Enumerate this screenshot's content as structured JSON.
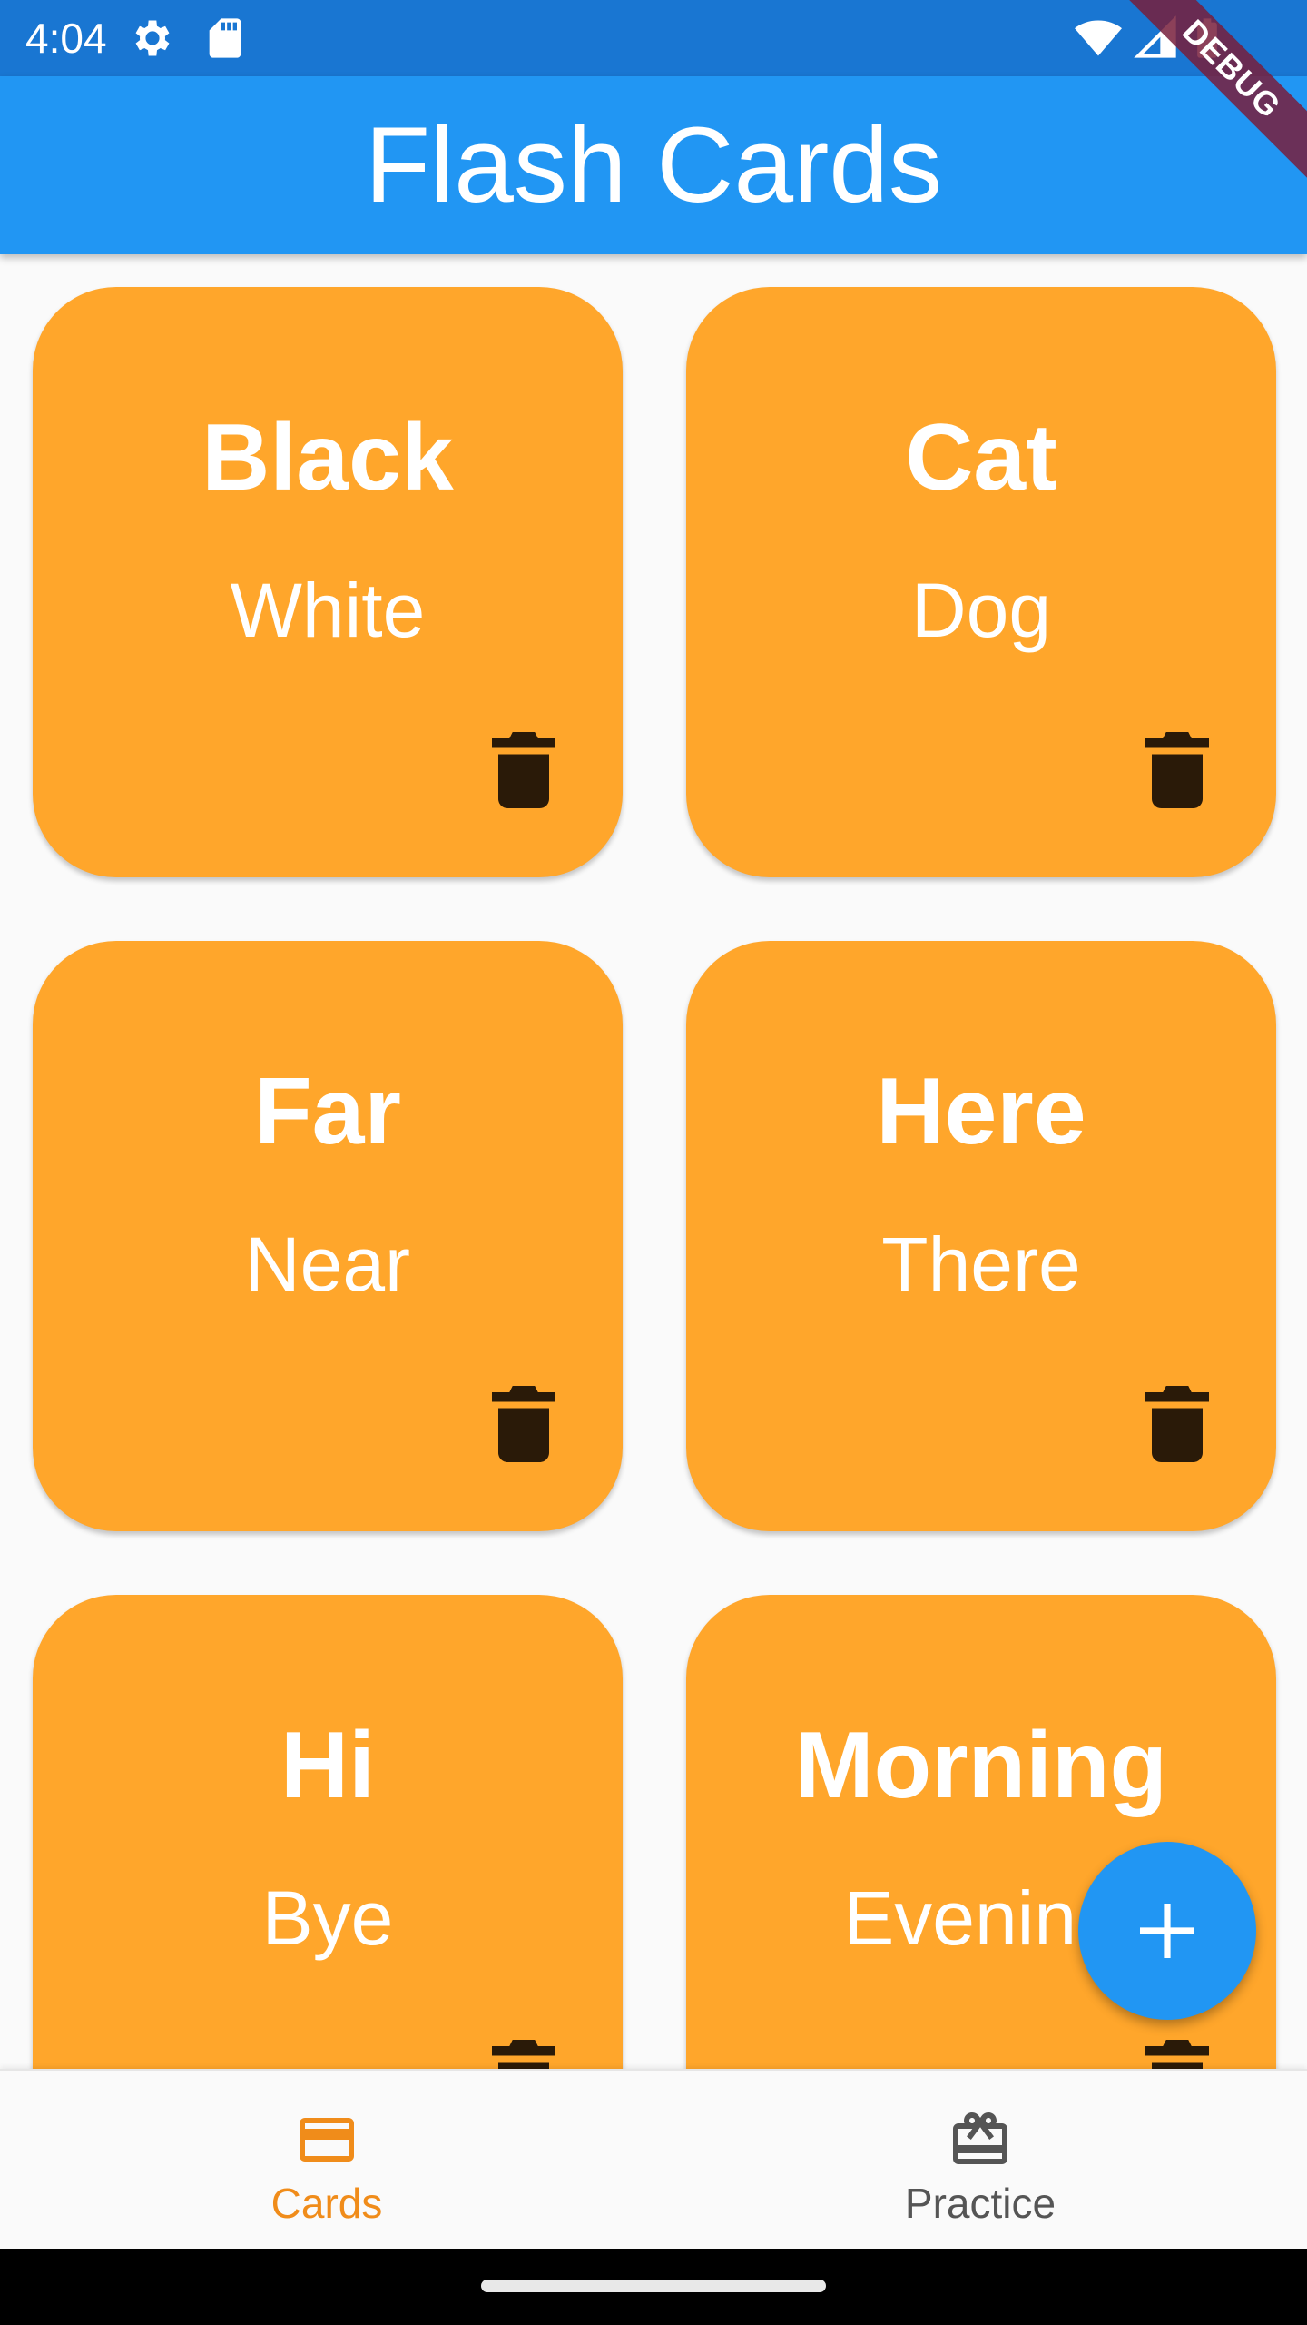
{
  "status_bar": {
    "time": "4:04",
    "icons": [
      "settings-icon",
      "sd-card-icon",
      "wifi-icon",
      "signal-icon",
      "battery-icon"
    ],
    "color": "#1976d2"
  },
  "app_bar": {
    "title": "Flash Cards",
    "color": "#2196f3"
  },
  "debug_banner": "DEBUG",
  "cards": [
    {
      "front": "Black",
      "back": "White"
    },
    {
      "front": "Cat",
      "back": "Dog"
    },
    {
      "front": "Far",
      "back": "Near"
    },
    {
      "front": "Here",
      "back": "There"
    },
    {
      "front": "Hi",
      "back": "Bye"
    },
    {
      "front": "Morning",
      "back": "Evening"
    }
  ],
  "card_style": {
    "color": "#ffa62b",
    "delete_icon": "delete-icon"
  },
  "fab": {
    "icon": "add-icon",
    "color": "#2196f3"
  },
  "bottom_nav": {
    "items": [
      {
        "label": "Cards",
        "icon": "credit-card-icon",
        "active": true
      },
      {
        "label": "Practice",
        "icon": "card-giftcard-icon",
        "active": false
      }
    ],
    "active_color": "#f08c1a",
    "inactive_color": "#555555"
  }
}
